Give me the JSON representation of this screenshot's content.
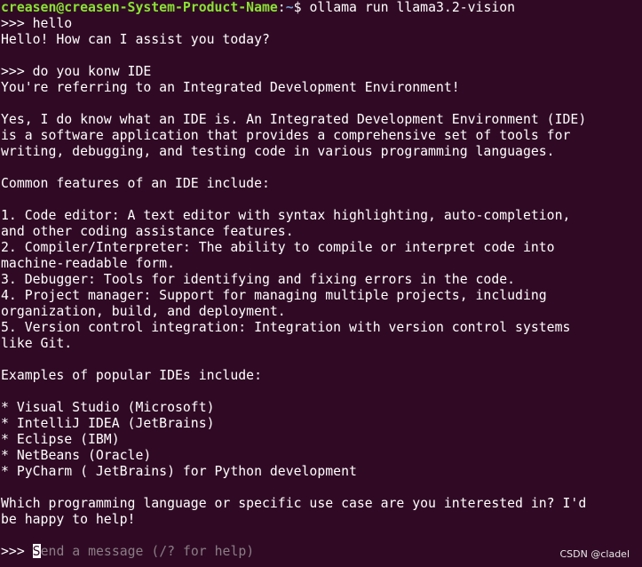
{
  "prompt": {
    "user_host": "creasen@creasen-System-Product-Name",
    "separator": ":",
    "path": "~",
    "symbol": "$ ",
    "command": "ollama run llama3.2-vision"
  },
  "lines": {
    "l01": ">>> hello",
    "l02": "Hello! How can I assist you today?",
    "l03": "",
    "l04": ">>> do you konw IDE",
    "l05": "You're referring to an Integrated Development Environment!",
    "l06": "",
    "l07": "Yes, I do know what an IDE is. An Integrated Development Environment (IDE)",
    "l08": "is a software application that provides a comprehensive set of tools for",
    "l09": "writing, debugging, and testing code in various programming languages.",
    "l10": "",
    "l11": "Common features of an IDE include:",
    "l12": "",
    "l13": "1. Code editor: A text editor with syntax highlighting, auto-completion,",
    "l14": "and other coding assistance features.",
    "l15": "2. Compiler/Interpreter: The ability to compile or interpret code into",
    "l16": "machine-readable form.",
    "l17": "3. Debugger: Tools for identifying and fixing errors in the code.",
    "l18": "4. Project manager: Support for managing multiple projects, including",
    "l19": "organization, build, and deployment.",
    "l20": "5. Version control integration: Integration with version control systems",
    "l21": "like Git.",
    "l22": "",
    "l23": "Examples of popular IDEs include:",
    "l24": "",
    "l25": "* Visual Studio (Microsoft)",
    "l26": "* IntelliJ IDEA (JetBrains)",
    "l27": "* Eclipse (IBM)",
    "l28": "* NetBeans (Oracle)",
    "l29": "* PyCharm ( JetBrains) for Python development",
    "l30": "",
    "l31": "Which programming language or specific use case are you interested in? I'd",
    "l32": "be happy to help!",
    "l33": ""
  },
  "input": {
    "prompt": ">>> ",
    "cursor_char": "S",
    "placeholder_rest": "end a message (/? for help)"
  },
  "watermark": "CSDN @cladel",
  "colors": {
    "background": "#300a24",
    "text": "#ffffff",
    "user_host": "#8ae234",
    "path": "#729fcf",
    "placeholder": "#8a7d85"
  }
}
